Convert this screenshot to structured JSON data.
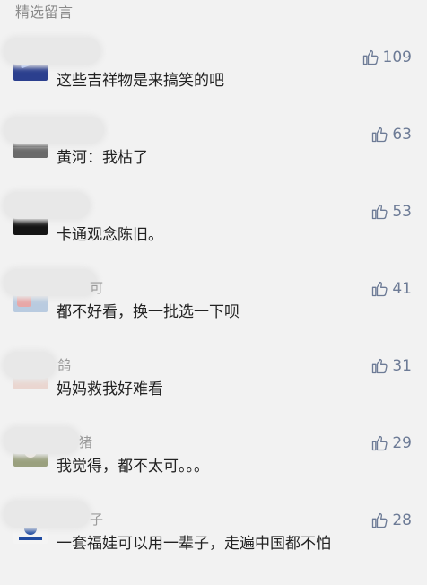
{
  "header": {
    "title": "精选留言"
  },
  "comments": [
    {
      "name_fragment": "",
      "content": "这些吉祥物是来搞笑的吧",
      "likes": "109",
      "avatar_color": "#2b3f8e"
    },
    {
      "name_fragment": "",
      "content": "黄河：我枯了",
      "likes": "63",
      "avatar_color": "#3a3a3a"
    },
    {
      "name_fragment": "",
      "content": "卡通观念陈旧。",
      "likes": "53",
      "avatar_color": "#141414"
    },
    {
      "name_fragment": "可",
      "content": "都不好看，换一批选一下呗",
      "likes": "41",
      "avatar_color": "#b9cbe0"
    },
    {
      "name_fragment": "鸽",
      "content": "妈妈救我好难看",
      "likes": "31",
      "avatar_color": "#ead6d0"
    },
    {
      "name_fragment": "猪",
      "content": "我觉得，都不太可。。。",
      "likes": "29",
      "avatar_color": "#9aa07e"
    },
    {
      "name_fragment": "子",
      "content": "一套福娃可以用一辈子，走遍中国都不怕",
      "likes": "28",
      "avatar_color": "#1f4aa0"
    }
  ]
}
